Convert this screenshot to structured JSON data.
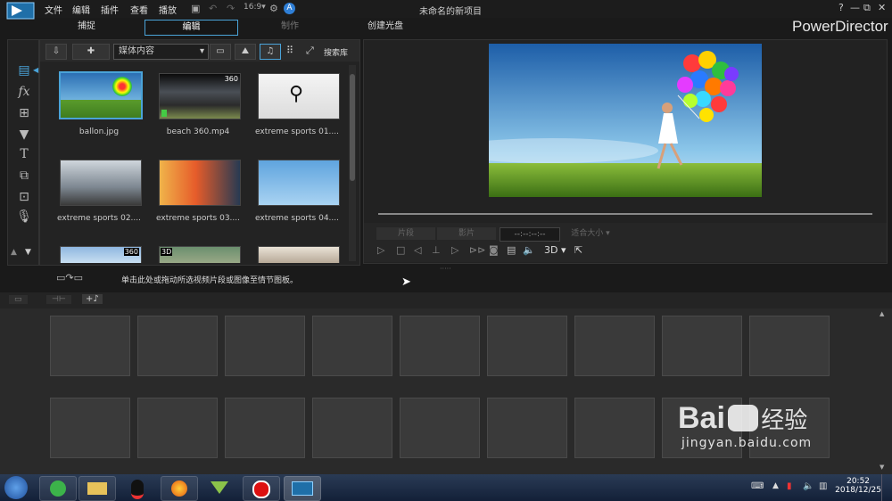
{
  "menu": [
    "文件",
    "编辑",
    "插件",
    "查看",
    "播放"
  ],
  "window_title": "未命名的新项目",
  "brand": "PowerDirector",
  "window_buttons": {
    "help": "?",
    "minimize": "—",
    "restore": "⧉",
    "close": "✕"
  },
  "mode_tabs": [
    {
      "label": "捕捉"
    },
    {
      "label": "编辑"
    },
    {
      "label": "制作"
    },
    {
      "label": "创建光盘"
    }
  ],
  "left_tools": [
    "fx",
    "T"
  ],
  "library": {
    "dropdown": "媒体内容",
    "search": "搜索库",
    "items": [
      {
        "label": "ballon.jpg"
      },
      {
        "label": "beach 360.mp4",
        "badge": "360"
      },
      {
        "label": "extreme sports 01...."
      },
      {
        "label": "extreme sports 02...."
      },
      {
        "label": "extreme sports 03...."
      },
      {
        "label": "extreme sports 04...."
      }
    ],
    "partial_badges": [
      "360",
      "3D"
    ]
  },
  "preview": {
    "btn_clip": "片段",
    "btn_movie": "影片",
    "timecode": "--:--:--:--",
    "fit": "适合大小",
    "mode_3d": "3D"
  },
  "hint": "单击此处或拖动所选视频片段或图像至情节图板。",
  "watermark": {
    "brand": "Bai",
    "suffix": "经验",
    "url": "jingyan.baidu.com"
  },
  "clock": {
    "time": "20:52",
    "date": "2018/12/25"
  },
  "colors": {
    "accent": "#4aa3d8",
    "bg": "#1a1a1a"
  }
}
